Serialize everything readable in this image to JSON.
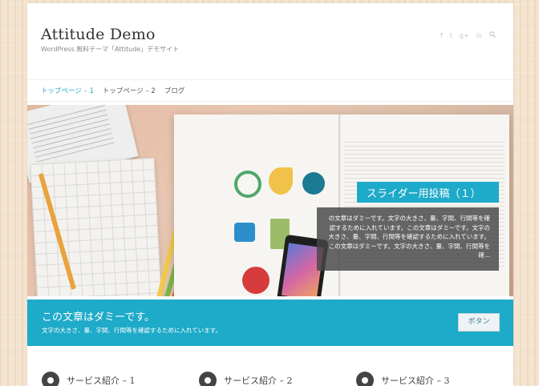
{
  "site": {
    "title": "Attitude Demo",
    "description": "WordPress 無料テーマ「Attitude」デモサイト"
  },
  "social_icons": [
    "facebook-icon",
    "twitter-icon",
    "google-plus-icon",
    "linkedin-icon",
    "search-icon"
  ],
  "nav": {
    "items": [
      {
        "label": "トップページ – 1",
        "active": true
      },
      {
        "label": "トップページ – 2",
        "active": false
      },
      {
        "label": "ブログ",
        "active": false
      }
    ]
  },
  "slider": {
    "title": "スライダー用投稿（１）",
    "text": "の文章はダミーです。文字の大きさ、量、字間、行間等を確認するために入れています。この文章はダミーです。文字の大きさ、量、字間、行間等を確認するために入れています。 この文章はダミーです。文字の大きさ、量、字間、行間等を確..."
  },
  "cta": {
    "title": "この文章はダミーです。",
    "text": "文字の大きさ、量、字間、行間等を確認するために入れています。",
    "button_label": "ボタン"
  },
  "services": [
    {
      "label": "サービス紹介 – 1",
      "icon": "gear-icon"
    },
    {
      "label": "サービス紹介 – 2",
      "icon": "lightbulb-icon"
    },
    {
      "label": "サービス紹介 – 3",
      "icon": "wrench-icon"
    }
  ],
  "colors": {
    "accent": "#1eaac9",
    "nav_active": "#29a5cc"
  }
}
